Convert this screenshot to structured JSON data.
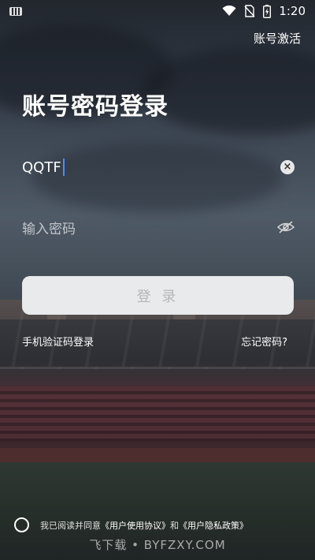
{
  "status_bar": {
    "time": "1:20",
    "icons": [
      "keyboard-icon",
      "wifi-icon",
      "no-sim-icon",
      "battery-charging-icon"
    ]
  },
  "header": {
    "activate_label": "账号激活"
  },
  "main": {
    "title": "账号密码登录",
    "account_input": {
      "value": "QQTF"
    },
    "password_input": {
      "placeholder": "输入密码"
    },
    "login_button": "登 录",
    "sms_login_link": "手机验证码登录",
    "forgot_password_link": "忘记密码?"
  },
  "agreement": {
    "prefix": "我已阅读并同意",
    "user_agreement": "《用户使用协议》",
    "conjunction": "和",
    "privacy_policy": "《用户隐私政策》"
  },
  "watermark": "飞下载 • BYFZXY.COM",
  "colors": {
    "button_bg": "#e9eaec",
    "button_text": "#b4b6ba",
    "caret": "#4f8cff"
  }
}
